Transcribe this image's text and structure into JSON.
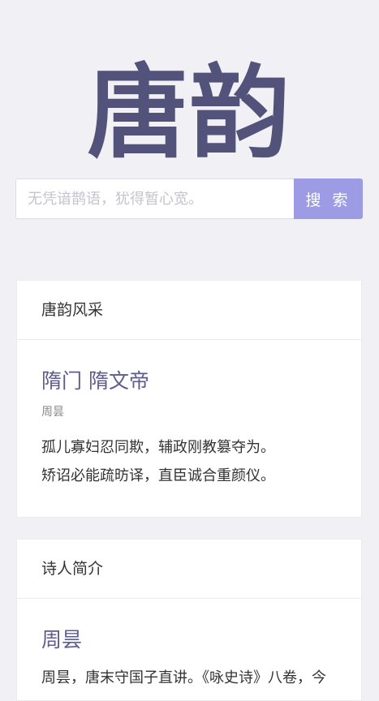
{
  "brand": {
    "logo_text": "唐韵"
  },
  "search": {
    "placeholder": "无凭谙鹊语，犹得暂心宽。",
    "button_label": "搜 索"
  },
  "featured_poem": {
    "section_title": "唐韵风采",
    "title": "隋门 隋文帝",
    "author": "周昙",
    "lines": [
      "孤儿寡妇忍同欺，辅政刚教篡夺为。",
      "矫诏必能疏昉译，直臣诚合重颜仪。"
    ]
  },
  "poet_intro": {
    "section_title": "诗人简介",
    "name": "周昙",
    "bio": "周昙，唐末守国子直讲。《咏史诗》八卷，今"
  },
  "colors": {
    "background": "#f0f0f5",
    "logo": "#53527a",
    "accent_button": "#9c9be4",
    "title_text": "#5d5b8f"
  }
}
